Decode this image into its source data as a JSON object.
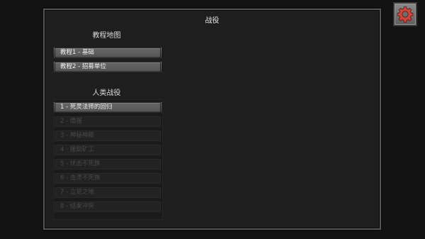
{
  "panel": {
    "title": "战役"
  },
  "tutorial": {
    "title": "教程地图",
    "items": [
      {
        "label": "教程1 - 基础",
        "locked": false
      },
      {
        "label": "教程2 - 招募单位",
        "locked": false
      }
    ]
  },
  "campaign": {
    "title": "人类战役",
    "items": [
      {
        "label": "1 - 死灵法师的回归",
        "locked": false
      },
      {
        "label": "2 - 情报",
        "locked": true
      },
      {
        "label": "3 - 神秘神殿",
        "locked": true
      },
      {
        "label": "4 - 援助矿工",
        "locked": true
      },
      {
        "label": "5 - 伏击不死族",
        "locked": true
      },
      {
        "label": "6 - 击溃不死族",
        "locked": true
      },
      {
        "label": "7 - 立足之地",
        "locked": true
      },
      {
        "label": "8 - 结束冲突",
        "locked": true
      }
    ]
  },
  "settings": {
    "icon": "gear-icon",
    "accent": "#c0392b"
  }
}
